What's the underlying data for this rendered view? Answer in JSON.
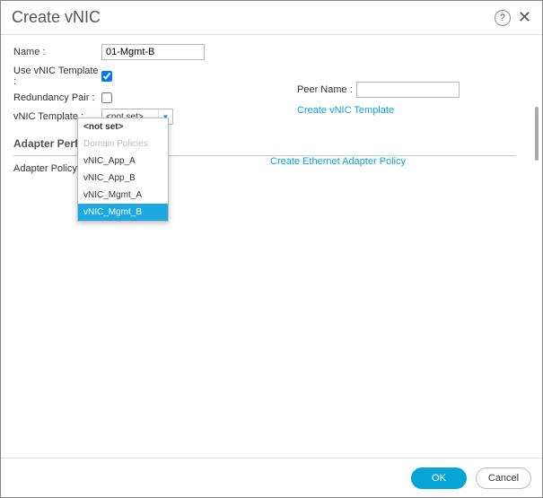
{
  "dialog": {
    "title": "Create vNIC",
    "help_glyph": "?",
    "close_glyph": "✕"
  },
  "form": {
    "name_label": "Name",
    "name_value": "01-Mgmt-B",
    "use_template_label": "Use vNIC Template",
    "use_template_checked": true,
    "redundancy_label": "Redundancy Pair",
    "redundancy_checked": false,
    "peer_name_label": "Peer Name",
    "peer_name_value": "",
    "vnic_template_label": "vNIC Template",
    "vnic_template_value": "<not set>",
    "dropdown_arrow": "▼",
    "create_vnic_link": "Create vNIC Template"
  },
  "section": {
    "heading": "Adapter Perfor",
    "adapter_policy_label": "Adapter Policy",
    "create_eth_link": "Create Ethernet Adapter Policy"
  },
  "dropdown": {
    "options": [
      {
        "label": "<not set>",
        "kind": "notset"
      },
      {
        "label": "Domain Policies",
        "kind": "header"
      },
      {
        "label": "vNIC_App_A",
        "kind": "item"
      },
      {
        "label": "vNIC_App_B",
        "kind": "item"
      },
      {
        "label": "vNIC_Mgmt_A",
        "kind": "item"
      },
      {
        "label": "vNIC_Mgmt_B",
        "kind": "selected"
      }
    ]
  },
  "footer": {
    "ok": "OK",
    "cancel": "Cancel"
  }
}
